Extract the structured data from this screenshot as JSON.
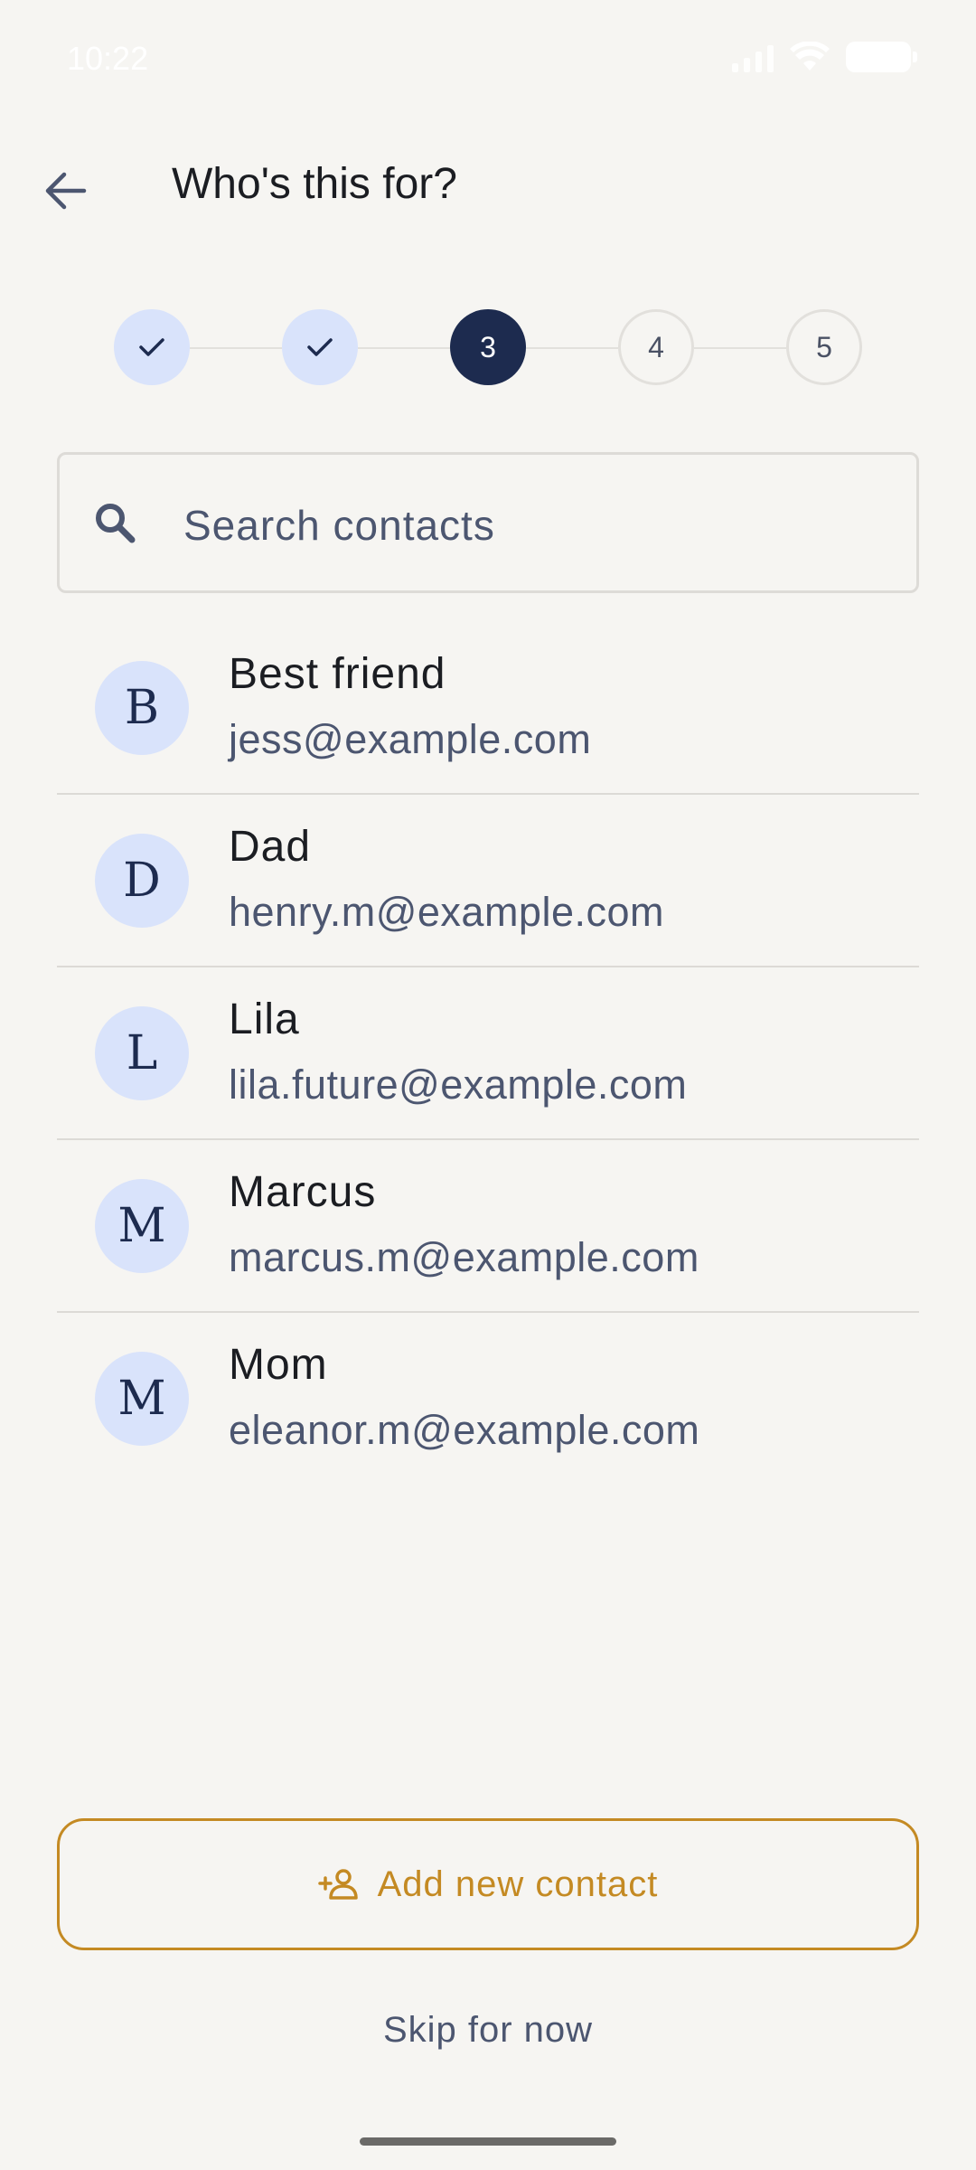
{
  "status_bar": {
    "time": "10:22"
  },
  "header": {
    "title": "Who's this for?",
    "back_icon": "arrow-left-icon"
  },
  "stepper": {
    "current_step": 3,
    "steps": [
      {
        "state": "done",
        "icon": "check-icon"
      },
      {
        "state": "done",
        "icon": "check-icon"
      },
      {
        "state": "active",
        "label": "3"
      },
      {
        "state": "pending",
        "label": "4"
      },
      {
        "state": "pending",
        "label": "5"
      }
    ]
  },
  "search": {
    "placeholder": "Search contacts",
    "value": ""
  },
  "contacts": [
    {
      "initial": "B",
      "name": "Best friend",
      "email": "jess@example.com"
    },
    {
      "initial": "D",
      "name": "Dad",
      "email": "henry.m@example.com"
    },
    {
      "initial": "L",
      "name": "Lila",
      "email": "lila.future@example.com"
    },
    {
      "initial": "M",
      "name": "Marcus",
      "email": "marcus.m@example.com"
    },
    {
      "initial": "M",
      "name": "Mom",
      "email": "eleanor.m@example.com"
    }
  ],
  "actions": {
    "add_contact_label": "Add new contact",
    "add_contact_icon": "add-person-icon",
    "skip_label": "Skip for now"
  },
  "colors": {
    "background": "#f6f5f2",
    "accent_navy": "#1d2b4f",
    "avatar_bg": "#d9e3fb",
    "gold": "#c48a23",
    "muted_text": "#4c5670"
  }
}
